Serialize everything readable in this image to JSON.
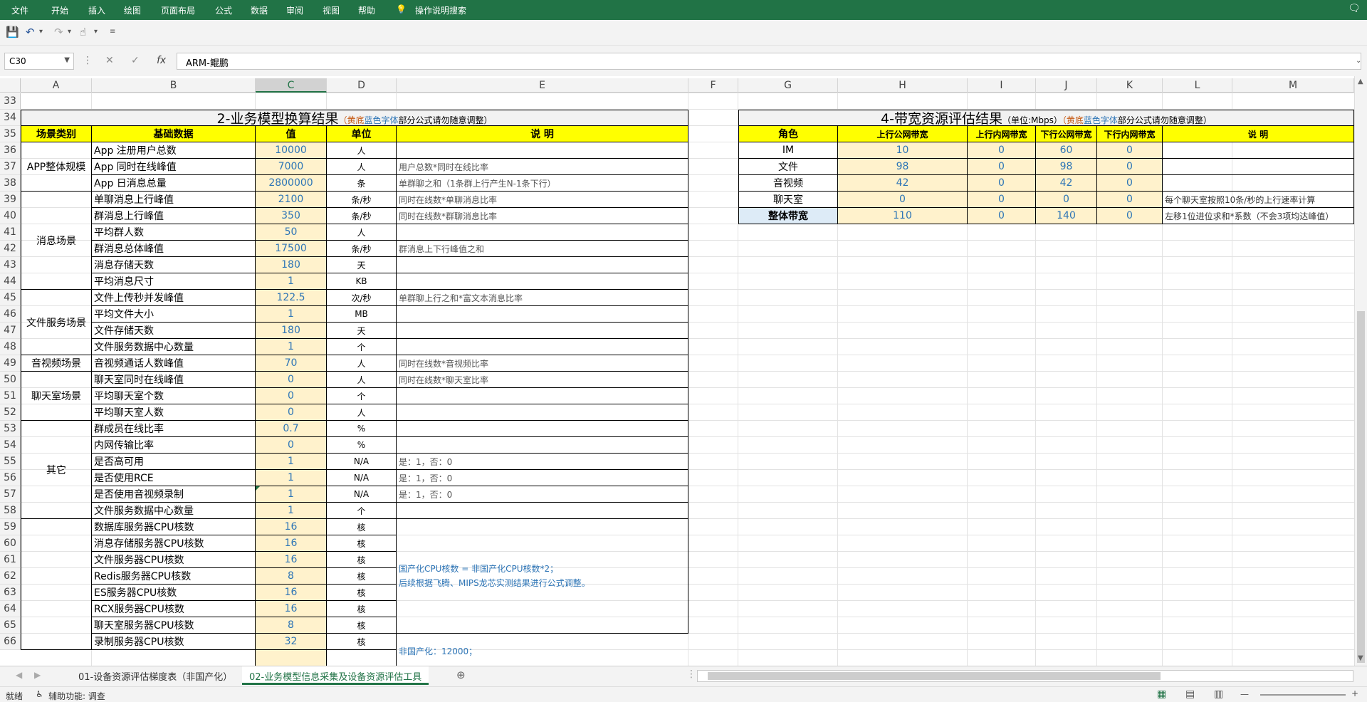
{
  "menu": [
    "文件",
    "开始",
    "插入",
    "绘图",
    "页面布局",
    "公式",
    "数据",
    "审阅",
    "视图",
    "帮助"
  ],
  "tell_me": "操作说明搜索",
  "name_box": "C30",
  "formula_value": "ARM-鲲鹏",
  "columns": [
    "A",
    "B",
    "C",
    "D",
    "E",
    "F",
    "G",
    "H",
    "I",
    "J",
    "K",
    "L",
    "M"
  ],
  "row_numbers": [
    "33",
    "34",
    "35",
    "36",
    "37",
    "38",
    "39",
    "40",
    "41",
    "42",
    "43",
    "44",
    "45",
    "46",
    "47",
    "48",
    "49",
    "50",
    "51",
    "52",
    "53",
    "54",
    "55",
    "56",
    "57",
    "58",
    "59",
    "60",
    "61",
    "62",
    "63",
    "64",
    "65",
    "66"
  ],
  "business": {
    "title": "2-业务模型换算结果",
    "note_1": "（黄底",
    "note_2": "蓝色字体",
    "note_3": "部分公式请勿随意调整）",
    "headers": [
      "场景类别",
      "基础数据",
      "值",
      "单位",
      "说 明"
    ],
    "groups": [
      "APP整体规模",
      "消息场景",
      "文件服务场景",
      "音视频场景",
      "聊天室场景",
      "其它"
    ],
    "rows": [
      {
        "name": "App 注册用户总数",
        "value": "10000",
        "unit": "人",
        "desc": ""
      },
      {
        "name": "App 同时在线峰值",
        "value": "7000",
        "unit": "人",
        "desc": "用户总数*同时在线比率"
      },
      {
        "name": "App 日消息总量",
        "value": "2800000",
        "unit": "条",
        "desc": "单群聊之和（1条群上行产生N-1条下行）"
      },
      {
        "name": "单聊消息上行峰值",
        "value": "2100",
        "unit": "条/秒",
        "desc": "同时在线数*单聊消息比率"
      },
      {
        "name": "群消息上行峰值",
        "value": "350",
        "unit": "条/秒",
        "desc": "同时在线数*群聊消息比率"
      },
      {
        "name": "平均群人数",
        "value": "50",
        "unit": "人",
        "desc": ""
      },
      {
        "name": "群消息总体峰值",
        "value": "17500",
        "unit": "条/秒",
        "desc": "群消息上下行峰值之和"
      },
      {
        "name": "消息存储天数",
        "value": "180",
        "unit": "天",
        "desc": ""
      },
      {
        "name": "平均消息尺寸",
        "value": "1",
        "unit": "KB",
        "desc": ""
      },
      {
        "name": "文件上传秒并发峰值",
        "value": "122.5",
        "unit": "次/秒",
        "desc": "单群聊上行之和*富文本消息比率"
      },
      {
        "name": "平均文件大小",
        "value": "1",
        "unit": "MB",
        "desc": ""
      },
      {
        "name": "文件存储天数",
        "value": "180",
        "unit": "天",
        "desc": ""
      },
      {
        "name": "文件服务数据中心数量",
        "value": "1",
        "unit": "个",
        "desc": ""
      },
      {
        "name": "音视频通话人数峰值",
        "value": "70",
        "unit": "人",
        "desc": "同时在线数*音视频比率"
      },
      {
        "name": "聊天室同时在线峰值",
        "value": "0",
        "unit": "人",
        "desc": "同时在线数*聊天室比率"
      },
      {
        "name": "平均聊天室个数",
        "value": "0",
        "unit": "个",
        "desc": ""
      },
      {
        "name": "平均聊天室人数",
        "value": "0",
        "unit": "人",
        "desc": ""
      },
      {
        "name": "群成员在线比率",
        "value": "0.7",
        "unit": "%",
        "desc": ""
      },
      {
        "name": "内网传输比率",
        "value": "0",
        "unit": "%",
        "desc": ""
      },
      {
        "name": "是否高可用",
        "value": "1",
        "unit": "N/A",
        "desc": "是：1，否：0"
      },
      {
        "name": "是否使用RCE",
        "value": "1",
        "unit": "N/A",
        "desc": "是：1，否：0"
      },
      {
        "name": "是否使用音视频录制",
        "value": "1",
        "unit": "N/A",
        "desc": "是：1，否：0"
      },
      {
        "name": "文件服务数据中心数量",
        "value": "1",
        "unit": "个",
        "desc": ""
      },
      {
        "name": "数据库服务器CPU核数",
        "value": "16",
        "unit": "核",
        "desc": ""
      },
      {
        "name": "消息存储服务器CPU核数",
        "value": "16",
        "unit": "核",
        "desc": ""
      },
      {
        "name": "文件服务器CPU核数",
        "value": "16",
        "unit": "核",
        "desc": ""
      },
      {
        "name": "Redis服务器CPU核数",
        "value": "8",
        "unit": "核",
        "desc": ""
      },
      {
        "name": "ES服务器CPU核数",
        "value": "16",
        "unit": "核",
        "desc": ""
      },
      {
        "name": "RCX服务器CPU核数",
        "value": "16",
        "unit": "核",
        "desc": ""
      },
      {
        "name": "聊天室服务器CPU核数",
        "value": "8",
        "unit": "核",
        "desc": ""
      },
      {
        "name": "录制服务器CPU核数",
        "value": "32",
        "unit": "核",
        "desc": ""
      }
    ],
    "cpu_note_1": "国产化CPU核数 = 非国产化CPU核数*2；",
    "cpu_note_2": "后续根据飞腾、MIPS龙芯实测结果进行公式调整。",
    "cut_note": "非国产化：12000；"
  },
  "bandwidth": {
    "title": "4-带宽资源评估结果",
    "unit_note": "（单位:Mbps）",
    "note_1": "（黄底",
    "note_2": "蓝色字体",
    "note_3": "部分公式请勿随意调整）",
    "headers": [
      "角色",
      "上行公网带宽",
      "上行内网带宽",
      "下行公网带宽",
      "下行内网带宽",
      "说 明"
    ],
    "rows": [
      {
        "role": "IM",
        "up_pub": "10",
        "up_int": "0",
        "down_pub": "60",
        "down_int": "0",
        "desc": ""
      },
      {
        "role": "文件",
        "up_pub": "98",
        "up_int": "0",
        "down_pub": "98",
        "down_int": "0",
        "desc": ""
      },
      {
        "role": "音视频",
        "up_pub": "42",
        "up_int": "0",
        "down_pub": "42",
        "down_int": "0",
        "desc": ""
      },
      {
        "role": "聊天室",
        "up_pub": "0",
        "up_int": "0",
        "down_pub": "0",
        "down_int": "0",
        "desc": "每个聊天室按照10条/秒的上行速率计算"
      },
      {
        "role": "整体带宽",
        "up_pub": "110",
        "up_int": "0",
        "down_pub": "140",
        "down_int": "0",
        "desc": "左移1位进位求和*系数（不会3项均达峰值）"
      }
    ]
  },
  "sheet_tabs": [
    "01-设备资源评估梯度表（非国产化）",
    "02-业务模型信息采集及设备资源评估工具"
  ],
  "status": {
    "ready": "就绪",
    "accessibility": "辅助功能: 调查"
  },
  "colors": {
    "ribbon": "#217346",
    "header_yellow": "#ffff00",
    "value_fill": "#fff2cc",
    "value_blue": "#2e75b6",
    "total_fill": "#ddebf7",
    "note_orange": "#c65911"
  }
}
